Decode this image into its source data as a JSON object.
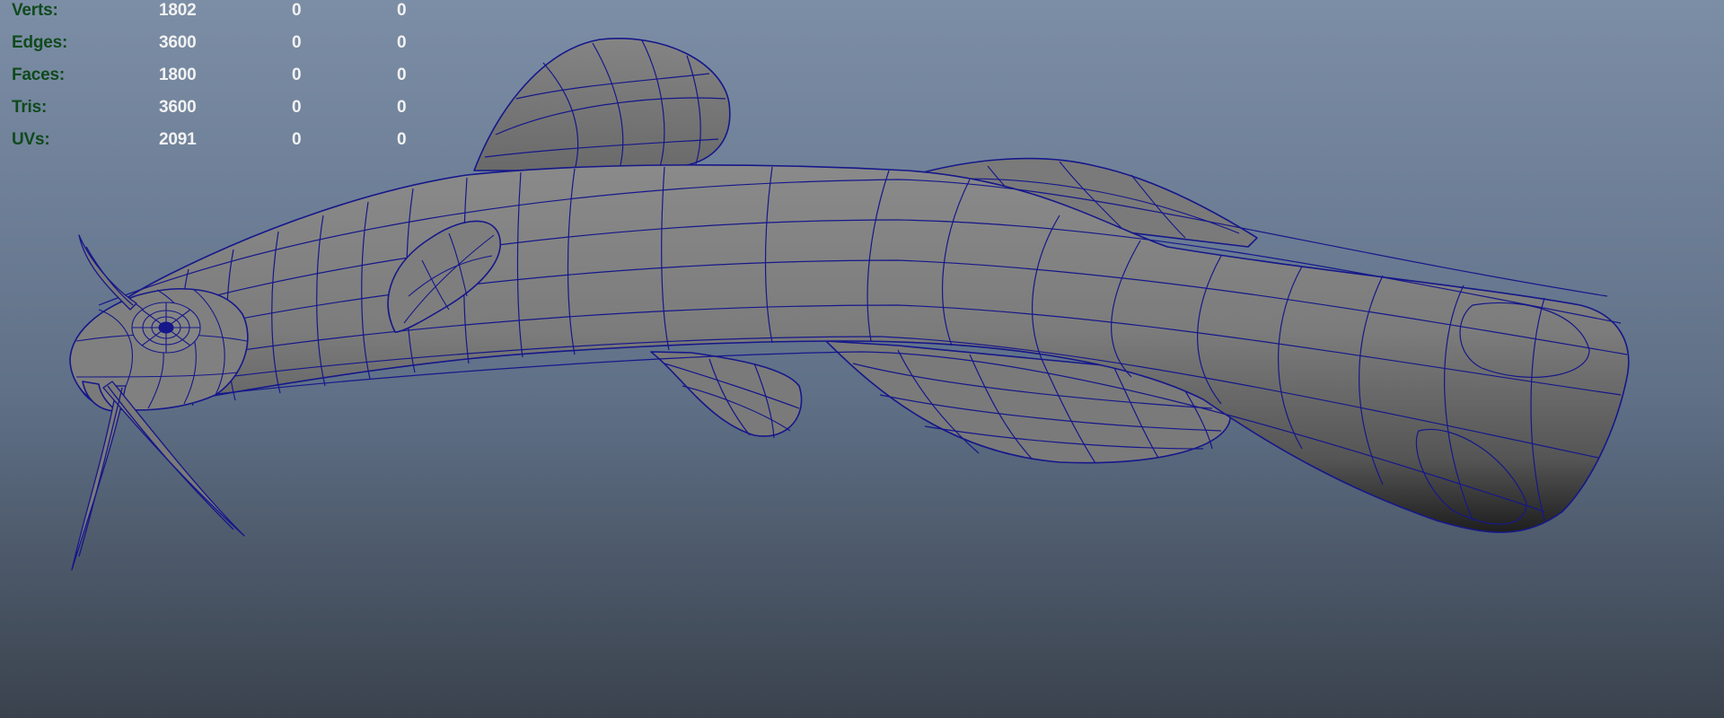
{
  "colors": {
    "background_top": "#7c8ea6",
    "background_mid": "#5f7087",
    "background_bottom": "#3a424d",
    "hud_label": "#0f4a1c",
    "hud_value": "#f2f2f2",
    "wireframe": "#15178a",
    "mesh_fill": "#7d7d7d",
    "mesh_shadow": "#2a2a2a"
  },
  "heads_up_display": {
    "rows": [
      {
        "label": "Verts:",
        "total": "1802",
        "selected": "0",
        "uvs_selected": "0"
      },
      {
        "label": "Edges:",
        "total": "3600",
        "selected": "0",
        "uvs_selected": "0"
      },
      {
        "label": "Faces:",
        "total": "1800",
        "selected": "0",
        "uvs_selected": "0"
      },
      {
        "label": "Tris:",
        "total": "3600",
        "selected": "0",
        "uvs_selected": "0"
      },
      {
        "label": "UVs:",
        "total": "2091",
        "selected": "0",
        "uvs_selected": "0"
      }
    ]
  },
  "viewport": {
    "object_icon": "fish-mesh-icon",
    "display_mode": "shaded-with-wireframe"
  }
}
